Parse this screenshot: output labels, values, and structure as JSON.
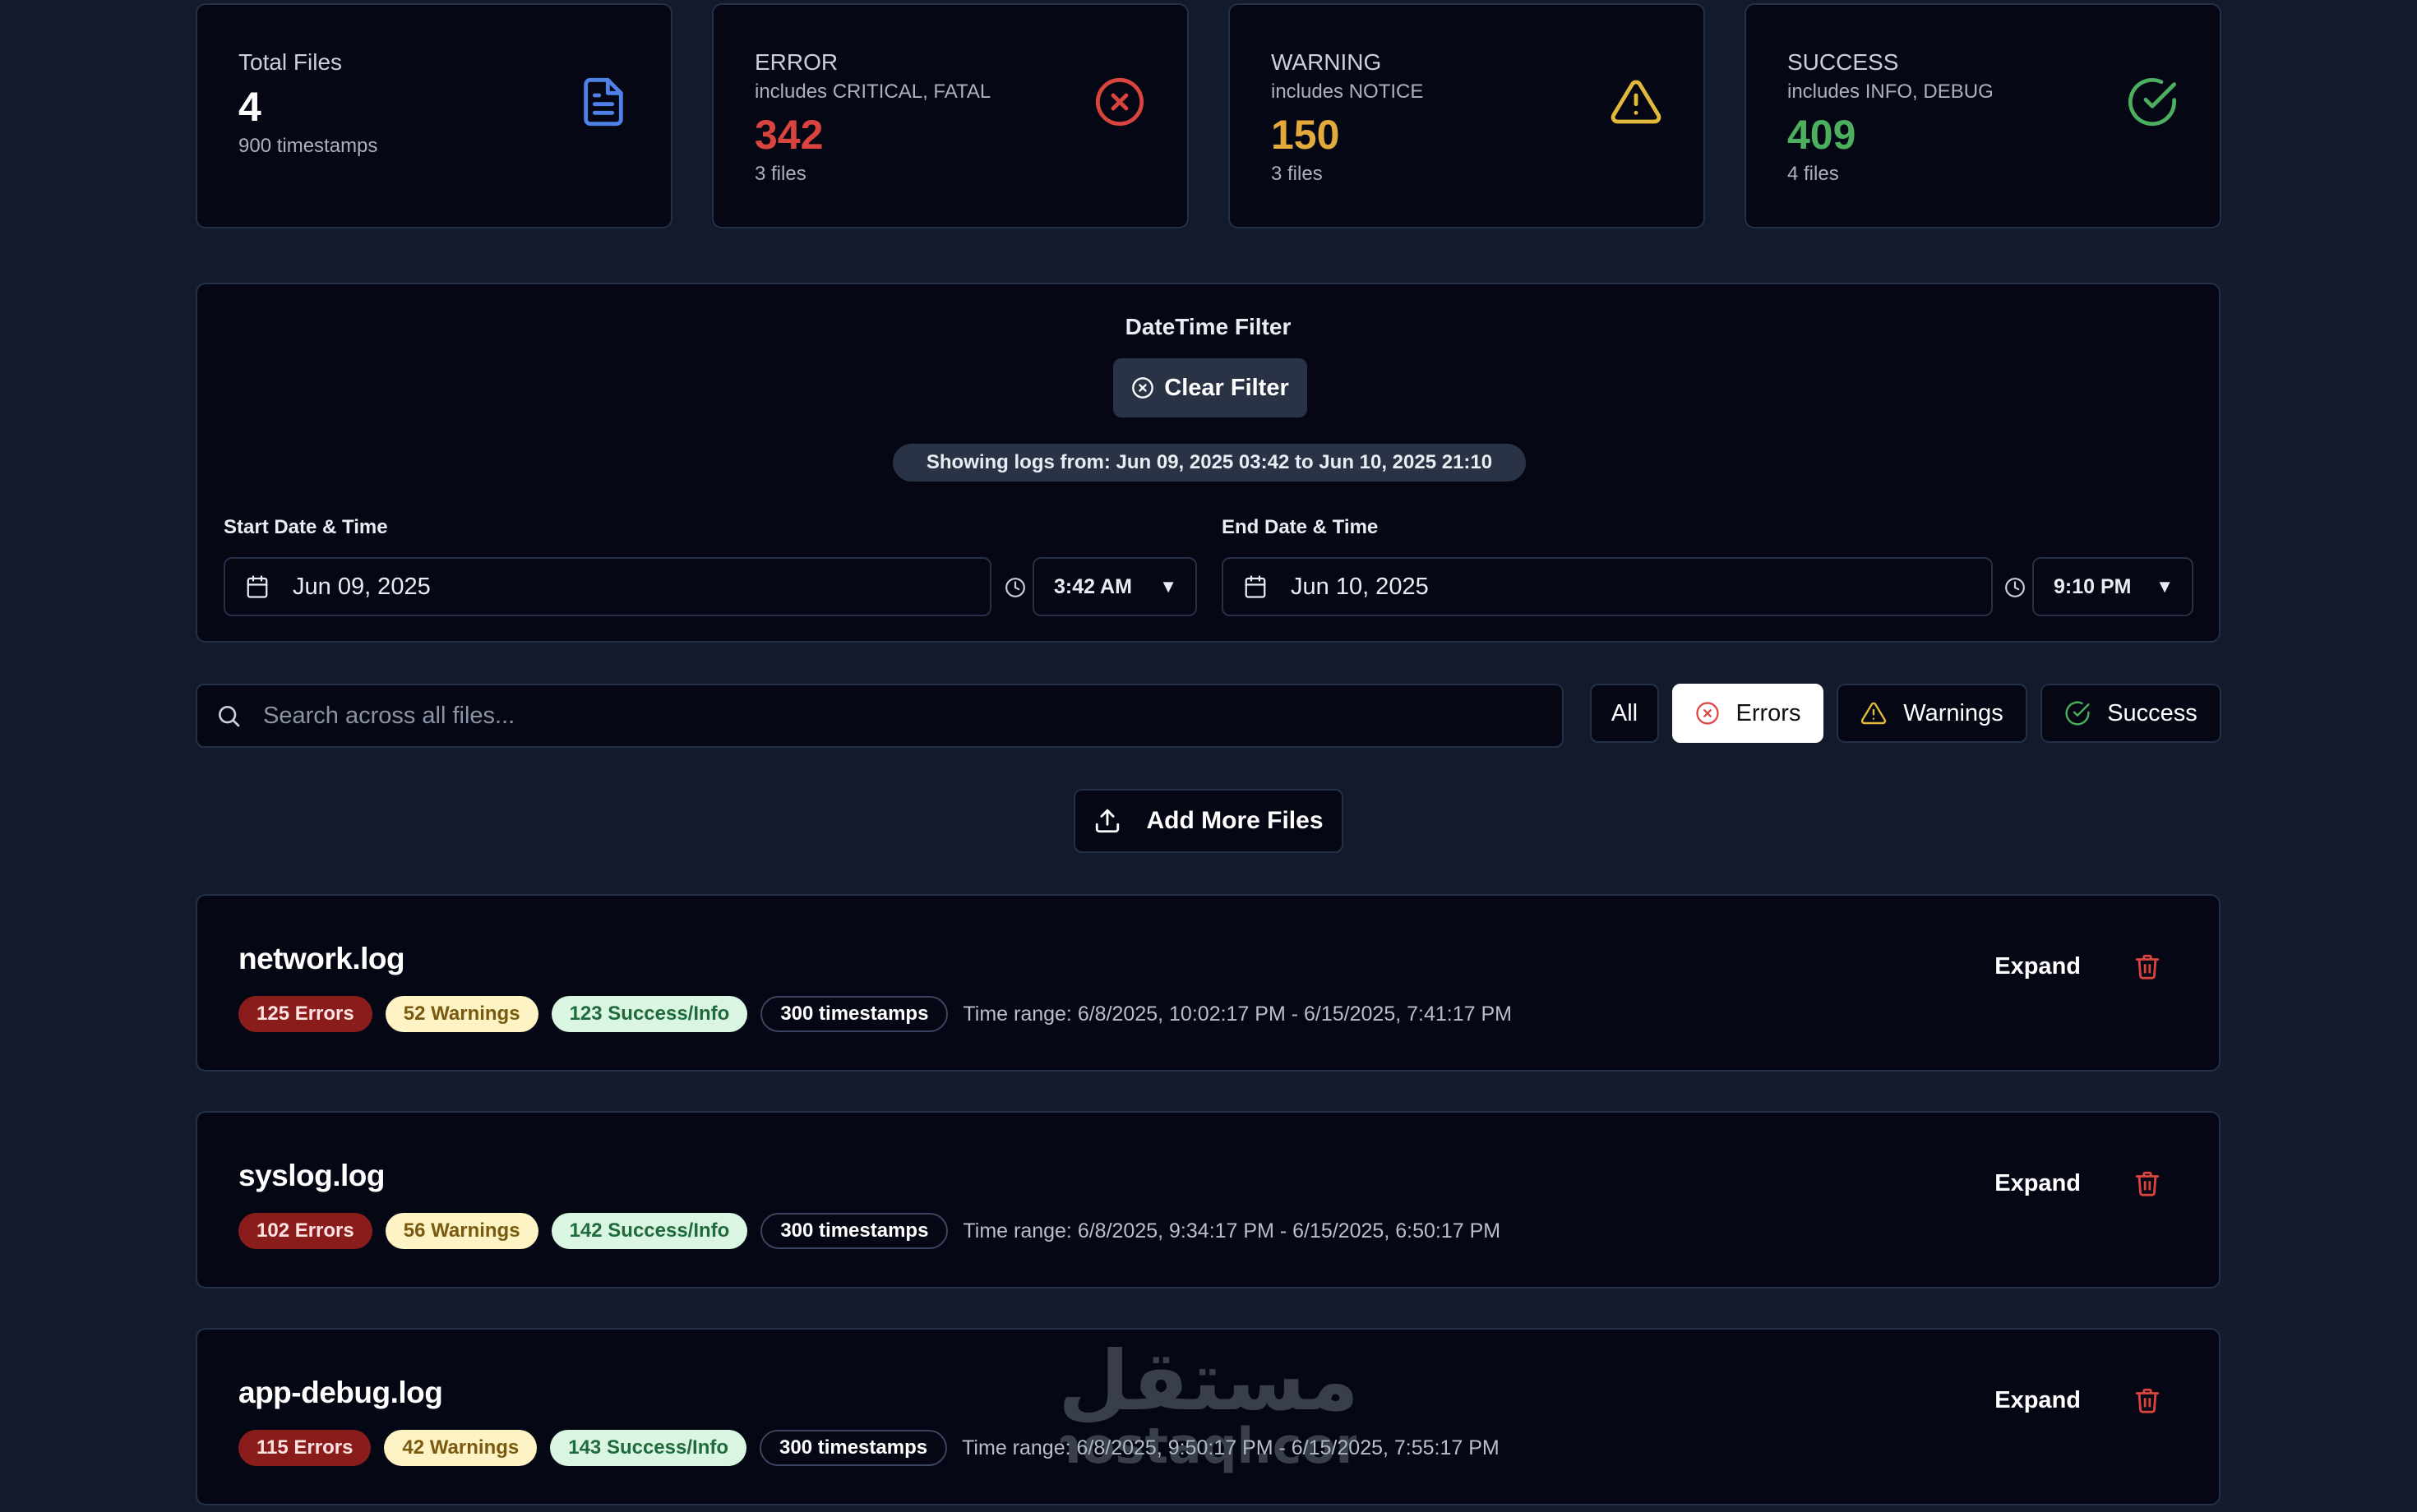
{
  "stats": {
    "total": {
      "title": "Total Files",
      "value": "4",
      "sub": "900 timestamps",
      "icon": "document-icon"
    },
    "error": {
      "title": "ERROR",
      "includes": "includes CRITICAL, FATAL",
      "value": "342",
      "sub": "3 files",
      "color": "#d9443f",
      "icon": "x-circle-icon"
    },
    "warning": {
      "title": "WARNING",
      "includes": "includes NOTICE",
      "value": "150",
      "sub": "3 files",
      "color": "#e3a93b",
      "icon": "warning-triangle-icon"
    },
    "success": {
      "title": "SUCCESS",
      "includes": "includes INFO, DEBUG",
      "value": "409",
      "sub": "4 files",
      "color": "#4caf5d",
      "icon": "check-circle-icon"
    }
  },
  "filter": {
    "title": "DateTime Filter",
    "clear_label": "Clear Filter",
    "range_text": "Showing logs from: Jun 09, 2025 03:42 to Jun 10, 2025 21:10",
    "start": {
      "label": "Start Date & Time",
      "date": "Jun 09, 2025",
      "time": "3:42 AM"
    },
    "end": {
      "label": "End Date & Time",
      "date": "Jun 10, 2025",
      "time": "9:10 PM"
    }
  },
  "search": {
    "placeholder": "Search across all files..."
  },
  "filters": {
    "all": "All",
    "errors": "Errors",
    "warnings": "Warnings",
    "success": "Success",
    "active": "errors"
  },
  "add_files_label": "Add More Files",
  "files": [
    {
      "name": "network.log",
      "errors": "125 Errors",
      "warnings": "52 Warnings",
      "success": "123 Success/Info",
      "timestamps": "300 timestamps",
      "time_range": "Time range: 6/8/2025, 10:02:17 PM - 6/15/2025, 7:41:17 PM",
      "expand": "Expand"
    },
    {
      "name": "syslog.log",
      "errors": "102 Errors",
      "warnings": "56 Warnings",
      "success": "142 Success/Info",
      "timestamps": "300 timestamps",
      "time_range": "Time range: 6/8/2025, 9:34:17 PM - 6/15/2025, 6:50:17 PM",
      "expand": "Expand"
    },
    {
      "name": "app-debug.log",
      "errors": "115 Errors",
      "warnings": "42 Warnings",
      "success": "143 Success/Info",
      "timestamps": "300 timestamps",
      "time_range": "Time range: 6/8/2025, 9:50:17 PM - 6/15/2025, 7:55:17 PM",
      "expand": "Expand"
    }
  ],
  "watermark": {
    "arabic": "مستقل",
    "latin": "mostaql.com"
  }
}
